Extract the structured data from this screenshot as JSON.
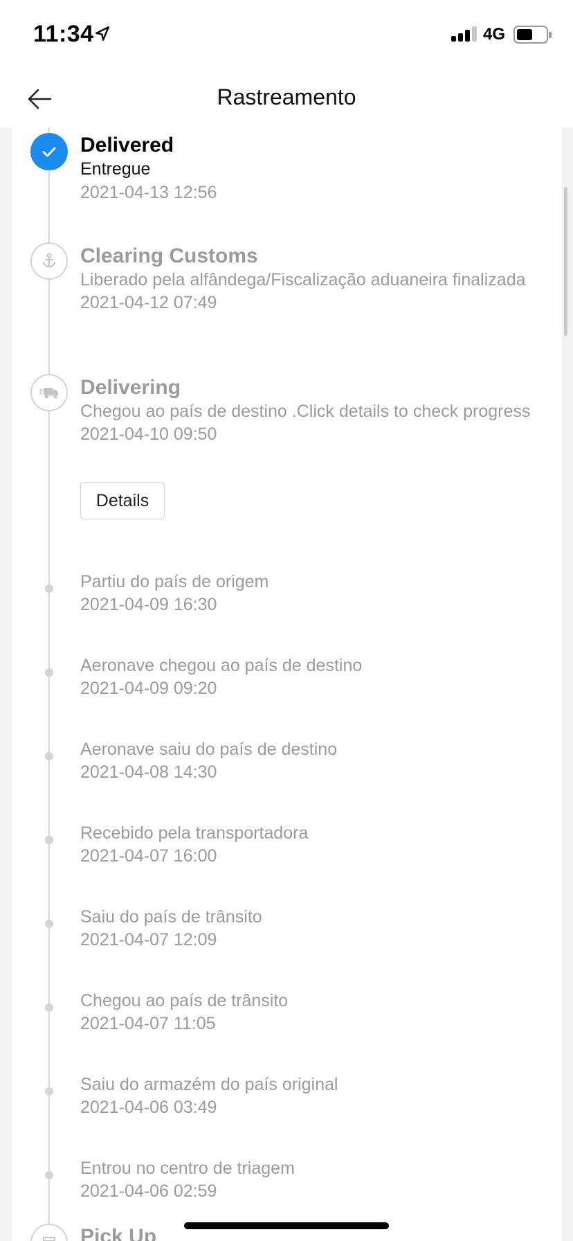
{
  "status_bar": {
    "time": "11:34",
    "network": "4G",
    "location_icon": "location-arrow-icon",
    "signal_icon": "cellular-signal-icon",
    "battery_icon": "battery-icon"
  },
  "nav": {
    "title": "Rastreamento",
    "back_icon": "arrow-left-icon"
  },
  "colors": {
    "accent": "#1a8cf0",
    "muted_text": "#9b9b9b",
    "line": "#d8d8d8"
  },
  "timeline": {
    "delivered": {
      "title": "Delivered",
      "description": "Entregue",
      "date": "2021-04-13 12:56",
      "icon": "check-icon"
    },
    "customs": {
      "title": "Clearing Customs",
      "description": "Liberado pela alfândega/Fiscalização aduaneira finalizada",
      "date": "2021-04-12 07:49",
      "icon": "anchor-icon"
    },
    "delivering": {
      "title": "Delivering",
      "description": "Chegou ao país de destino .Click details to check progress",
      "date": "2021-04-10 09:50",
      "icon": "truck-icon",
      "details_label": "Details"
    },
    "events": [
      {
        "description": "Partiu do país de origem",
        "date": "2021-04-09 16:30"
      },
      {
        "description": "Aeronave chegou ao país de destino",
        "date": "2021-04-09 09:20"
      },
      {
        "description": "Aeronave saiu do país de destino",
        "date": "2021-04-08 14:30"
      },
      {
        "description": "Recebido pela transportadora",
        "date": "2021-04-07 16:00"
      },
      {
        "description": "Saiu do país de trânsito",
        "date": "2021-04-07 12:09"
      },
      {
        "description": "Chegou ao país de trânsito",
        "date": "2021-04-07 11:05"
      },
      {
        "description": "Saiu do armazém do país original",
        "date": "2021-04-06 03:49"
      },
      {
        "description": "Entrou no centro de triagem",
        "date": "2021-04-06 02:59"
      }
    ],
    "pickup": {
      "title": "Pick Up",
      "icon": "package-icon"
    }
  }
}
